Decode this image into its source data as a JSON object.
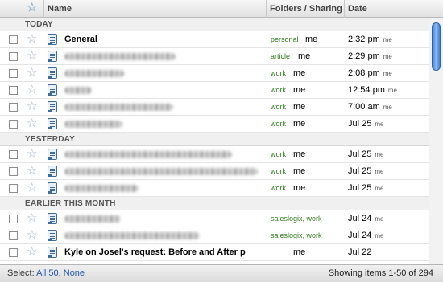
{
  "header": {
    "name": "Name",
    "folders": "Folders / Sharing",
    "date": "Date"
  },
  "sections": {
    "today": "TODAY",
    "yesterday": "YESTERDAY",
    "earlier": "EARLIER THIS MONTH"
  },
  "rows": [
    {
      "name": "General",
      "folder": "personal",
      "sharer": "me",
      "time": "2:32 pm",
      "by": "me"
    },
    {
      "name": "",
      "folder": "article",
      "sharer": "me",
      "time": "2:29 pm",
      "by": "me"
    },
    {
      "name": "",
      "folder": "work",
      "sharer": "me",
      "time": "2:08 pm",
      "by": "me"
    },
    {
      "name": "",
      "folder": "work",
      "sharer": "me",
      "time": "12:54 pm",
      "by": "me"
    },
    {
      "name": "",
      "folder": "work",
      "sharer": "me",
      "time": "7:00 am",
      "by": "me"
    },
    {
      "name": "",
      "folder": "work",
      "sharer": "me",
      "time": "Jul 25",
      "by": "me"
    },
    {
      "name": "",
      "folder": "work",
      "sharer": "me",
      "time": "Jul 25",
      "by": "me"
    },
    {
      "name": "",
      "folder": "work",
      "sharer": "me",
      "time": "Jul 25",
      "by": "me"
    },
    {
      "name": "",
      "folder": "work",
      "sharer": "me",
      "time": "Jul 25",
      "by": "me"
    },
    {
      "name": "",
      "folder": "saleslogix, work",
      "sharer": "",
      "time": "Jul 24",
      "by": "me"
    },
    {
      "name": "",
      "folder": "saleslogix, work",
      "sharer": "",
      "time": "Jul 24",
      "by": "me"
    },
    {
      "name": "Kyle on Josel's request: Before and After p",
      "folder": "",
      "sharer": "me",
      "time": "Jul 22",
      "by": ""
    }
  ],
  "footer": {
    "select_label": "Select:",
    "all": "All 50",
    "sep": ",",
    "none": "None",
    "count": "Showing items 1-50 of 294"
  }
}
